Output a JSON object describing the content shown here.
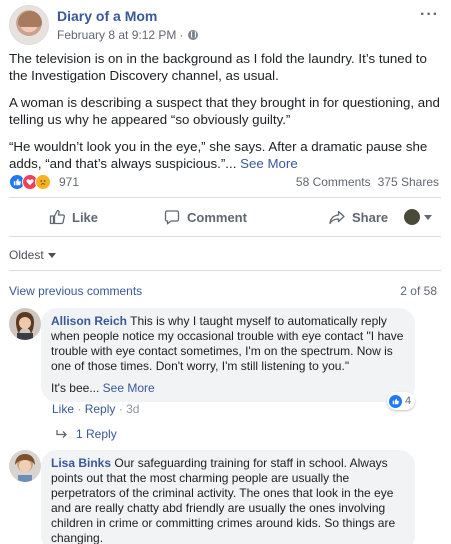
{
  "post": {
    "author": "Diary of a Mom",
    "timestamp": "February 8 at 9:12 PM",
    "separator": "·",
    "paragraphs": [
      "The television is on in the background as I fold the laundry. It’s tuned to the Investigation Discovery channel, as usual.",
      "A woman is describing a suspect that they brought in for questioning, and telling us why he appeared “so obviously guilty.”"
    ],
    "last_paragraph": "“He wouldn’t look you in the eye,” she says. After a dramatic pause she adds, “and that’s always suspicious.”...",
    "see_more": "See More"
  },
  "reactions": {
    "count": "971",
    "icons": [
      "like-icon",
      "love-icon",
      "sad-icon"
    ],
    "comments": "58 Comments",
    "shares": "375 Shares"
  },
  "actions": {
    "like": "Like",
    "comment": "Comment",
    "share": "Share"
  },
  "sort": {
    "label": "Oldest"
  },
  "comments_section": {
    "view_previous": "View previous comments",
    "count": "2 of 58"
  },
  "comments": [
    {
      "name": "Allison Reich",
      "text": "This is why I taught myself to automatically reply when people notice my occasional trouble with eye contact \"I have trouble with eye contact sometimes, I'm on the spectrum. Now is one of those times. Don't worry, I'm still listening to you.\"",
      "truncated": "It's bee...",
      "see_more": "See More",
      "like": "Like",
      "reply": "Reply",
      "time": "3d",
      "reaction_count": "4",
      "replies": "1 Reply"
    },
    {
      "name": "Lisa Binks",
      "text": "Our safeguarding training for staff in school. Always points out that the most charming people are usually the perpetrators of the criminal activity. The ones that look in the eye and are really chatty abd friendly are usually the ones involving children in crime or committing crimes around kids. So things are changing."
    }
  ],
  "colors": {
    "link": "#385898",
    "like_blue": "#2078f4",
    "muted": "#606770"
  }
}
